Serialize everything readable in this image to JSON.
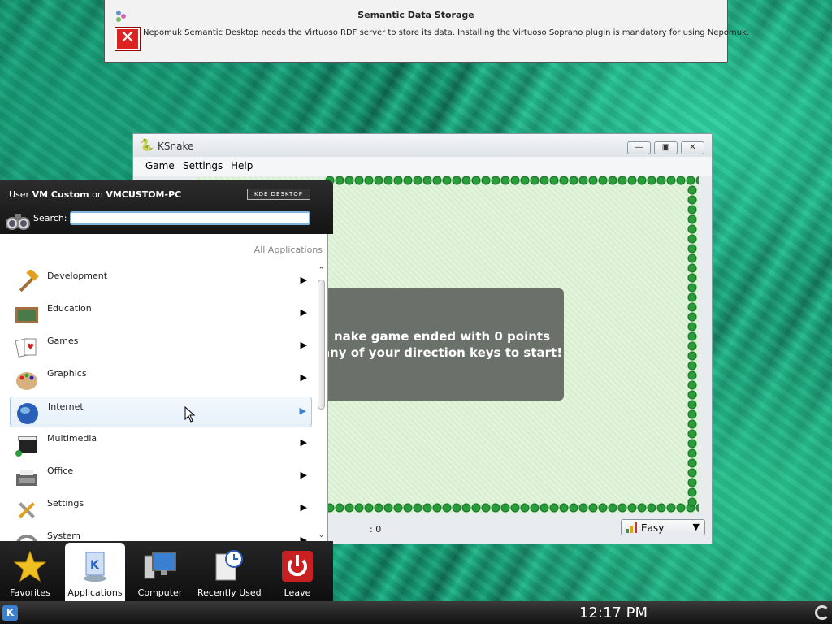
{
  "notification": {
    "title": "Semantic Data Storage",
    "message": "Nepomuk Semantic Desktop needs the Virtuoso RDF server to store its data. Installing the Virtuoso Soprano plugin is mandatory for using Nepomuk.",
    "app_icon": "nepomuk-icon",
    "status_icon": "error-icon"
  },
  "ksnake": {
    "title": "KSnake",
    "menu": [
      "Game",
      "Settings",
      "Help"
    ],
    "message_line1": "nake game ended with 0 points",
    "message_line2": "any of your direction keys to start!",
    "score": ": 0",
    "difficulty": "Easy"
  },
  "kickoff": {
    "user_prefix": "User",
    "user_name": "VM Custom",
    "host_sep": "on",
    "host_name": "VMCUSTOM-PC",
    "badge": "KDE DESKTOP",
    "search_label": "Search:",
    "search_value": "",
    "breadcrumb": "All Applications",
    "categories": [
      {
        "label": "Development",
        "icon": "hammer-icon"
      },
      {
        "label": "Education",
        "icon": "chalkboard-icon"
      },
      {
        "label": "Games",
        "icon": "cards-icon"
      },
      {
        "label": "Graphics",
        "icon": "palette-icon"
      },
      {
        "label": "Internet",
        "icon": "globe-icon"
      },
      {
        "label": "Multimedia",
        "icon": "clapperboard-icon"
      },
      {
        "label": "Office",
        "icon": "typewriter-icon"
      },
      {
        "label": "Settings",
        "icon": "tools-icon"
      },
      {
        "label": "System",
        "icon": "system-icon"
      }
    ],
    "tabs": [
      {
        "label": "Favorites",
        "icon": "star-icon"
      },
      {
        "label": "Applications",
        "icon": "applications-icon"
      },
      {
        "label": "Computer",
        "icon": "computer-icon"
      },
      {
        "label": "Recently Used",
        "icon": "clock-document-icon"
      },
      {
        "label": "Leave",
        "icon": "power-icon"
      }
    ]
  },
  "taskbar": {
    "clock": "12:17 PM"
  },
  "colors": {
    "wall": "#2a9c3a",
    "board": "#d8f0d0",
    "hover": "#3a82d0",
    "error": "#dd2222"
  }
}
